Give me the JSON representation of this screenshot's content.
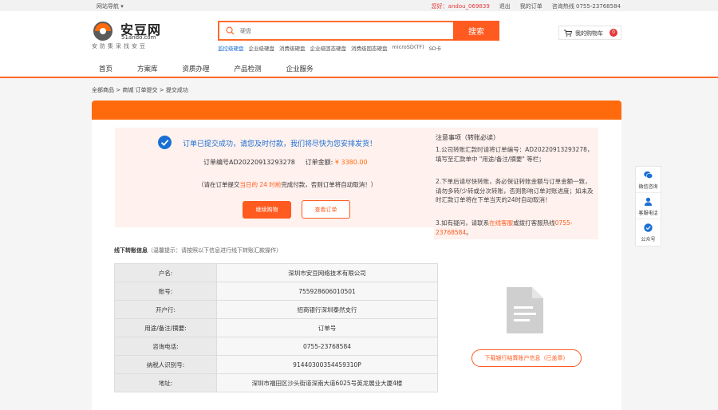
{
  "topbar": {
    "site_nav": "网站导航",
    "site_nav_arrow": "▾",
    "greeting": "您好：andou_069839",
    "logout": "退出",
    "my_orders": "我的订单",
    "hotline": "咨询热线 0755-23768584"
  },
  "logo": {
    "cn": "安豆网",
    "en": "51ando.com",
    "slogan": "安防集采找安豆"
  },
  "search": {
    "placeholder": "硬盘",
    "button": "搜索",
    "hotwords": [
      "监控级硬盘",
      "企业级硬盘",
      "消费级硬盘",
      "企业级固态硬盘",
      "消费级固态硬盘",
      "microSD(TF)",
      "SD卡"
    ]
  },
  "cart": {
    "label": "我的购物车",
    "count": "0"
  },
  "nav": {
    "items": [
      "首页",
      "方案库",
      "资质办理",
      "产品检测",
      "企业服务"
    ]
  },
  "breadcrumb": "全部商品 > 商城 订单提交 > 提交成功",
  "success": {
    "title": "订单已提交成功，请您及时付款，我们将尽快为您安排发货！",
    "order_no_label": "订单编号AD20220913293278",
    "amount_label": "订单金额:",
    "amount": "¥ 3380.00",
    "warn_prefix": "（请在订单提交",
    "warn_highlight": "当日的 24 时前",
    "warn_suffix": "完成付款，否则订单将自动取消！）",
    "continue_btn": "继续购物",
    "view_btn": "查看订单"
  },
  "notice": {
    "title": "注意事项（转账必读）",
    "item1": "1.公司转账汇款时请将订单编号：AD20220913293278，填写至汇款单中 \"用途/备注/摘要\" 等栏；",
    "item2": "2.下单后请尽快转账，务必保证转账金额与订单金额一致，请勿多转/少转或分次转账，否则影响订单对账进度；如未及时汇款订单将在下单当天的24时自动取消！",
    "item3_prefix": "3.如有疑问，请联系",
    "item3_link": "在线客服",
    "item3_mid": "或拨打客服热线",
    "item3_phone": "0755-23768584",
    "item3_suffix": "。"
  },
  "transfer": {
    "title": "线下转账信息",
    "tip": "（温馨提示：请按照以下信息进行线下转账汇款操作）",
    "rows": [
      {
        "k": "户名:",
        "v": "深圳市安豆网络技术有限公司"
      },
      {
        "k": "账号:",
        "v": "755928606010501"
      },
      {
        "k": "开户行:",
        "v": "招商银行深圳泰然支行"
      },
      {
        "k": "用途/备注/摘要:",
        "v": "订单号"
      },
      {
        "k": "咨询电话:",
        "v": "0755-23768584"
      },
      {
        "k": "纳税人识别号:",
        "v": "91440300354459310P"
      },
      {
        "k": "地址:",
        "v": "深圳市福田区沙头街道深南大道6025号英龙展业大厦4楼"
      }
    ],
    "download_btn": "下载银行结算账户信息（已盖章）"
  },
  "sidebar": {
    "wechat": "微信咨询",
    "customer": "客服电话",
    "official": "公众号"
  },
  "colors": {
    "accent": "#ff6a0c",
    "link": "#1a6fd4",
    "danger": "#e4393c"
  }
}
